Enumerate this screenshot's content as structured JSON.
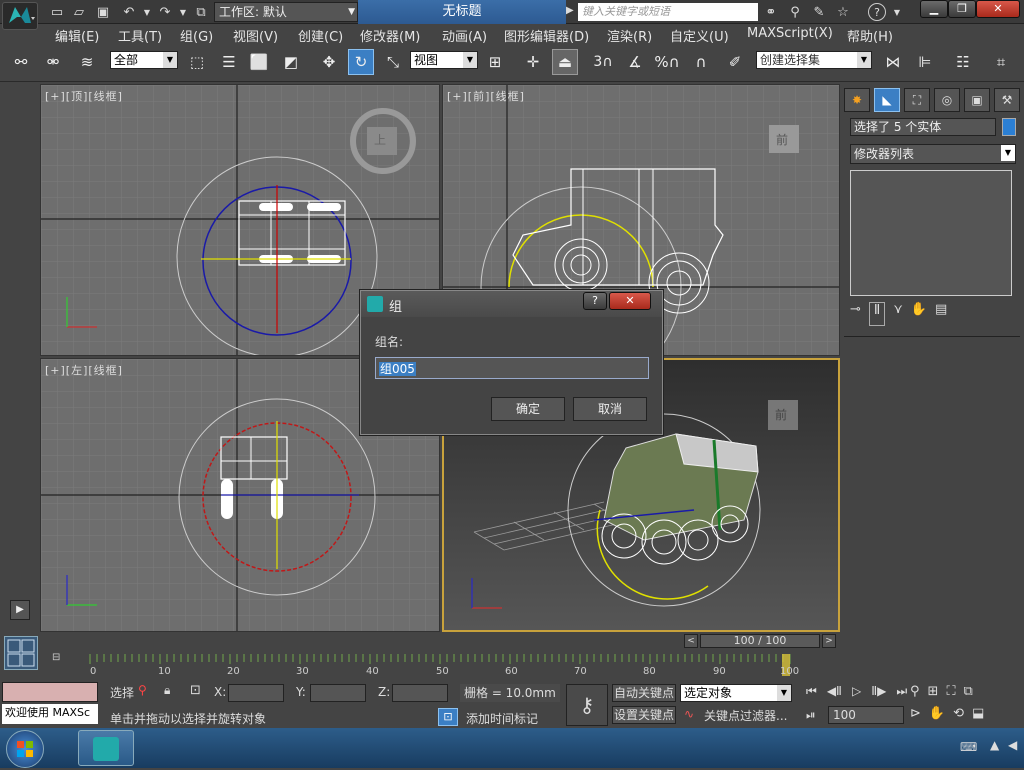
{
  "window": {
    "workspace_label": "工作区: 默认",
    "doc_title": "无标题",
    "search_placeholder": "键入关键字或短语"
  },
  "menus": [
    "编辑(E)",
    "工具(T)",
    "组(G)",
    "视图(V)",
    "创建(C)",
    "修改器(M)",
    "动画(A)",
    "图形编辑器(D)",
    "渲染(R)",
    "自定义(U)",
    "MAXScript(X)",
    "帮助(H)"
  ],
  "toolbar": {
    "filter_value": "全部",
    "ref_coord_value": "视图",
    "named_selection_placeholder": "创建选择集",
    "snap_label": "3",
    "percent_label": "%"
  },
  "viewports": {
    "top_label": "[+][顶][线框]",
    "front_label": "[+][前][线框]",
    "left_label": "[+][左][线框]",
    "front_cube_label": "前",
    "top_cube_label": "上",
    "persp_cube_label": "前"
  },
  "command_panel": {
    "selection_info": "选择了 5 个实体",
    "modifier_list": "修改器列表"
  },
  "dialog": {
    "title": "组",
    "name_label": "组名:",
    "name_value": "组005",
    "ok_label": "确定",
    "cancel_label": "取消"
  },
  "timeline": {
    "frame_display": "100 / 100",
    "ticks": [
      "0",
      "10",
      "20",
      "30",
      "40",
      "50",
      "60",
      "70",
      "80",
      "90",
      "100"
    ]
  },
  "status": {
    "welcome_text": "欢迎使用 MAXSc",
    "select_label": "选择",
    "x_label": "X:",
    "y_label": "Y:",
    "z_label": "Z:",
    "grid_text": "栅格 = 10.0mm",
    "prompt_text": "单击并拖动以选择并旋转对象",
    "add_time_tag": "添加时间标记",
    "auto_key": "自动关键点",
    "set_key": "设置关键点",
    "key_mode_value": "选定对象",
    "key_filters": "关键点过滤器...",
    "current_frame": "100"
  },
  "colors": {
    "accent_blue": "#3b7fc4",
    "viewport_bg": "#6e6e6e",
    "panel_bg": "#444444"
  }
}
